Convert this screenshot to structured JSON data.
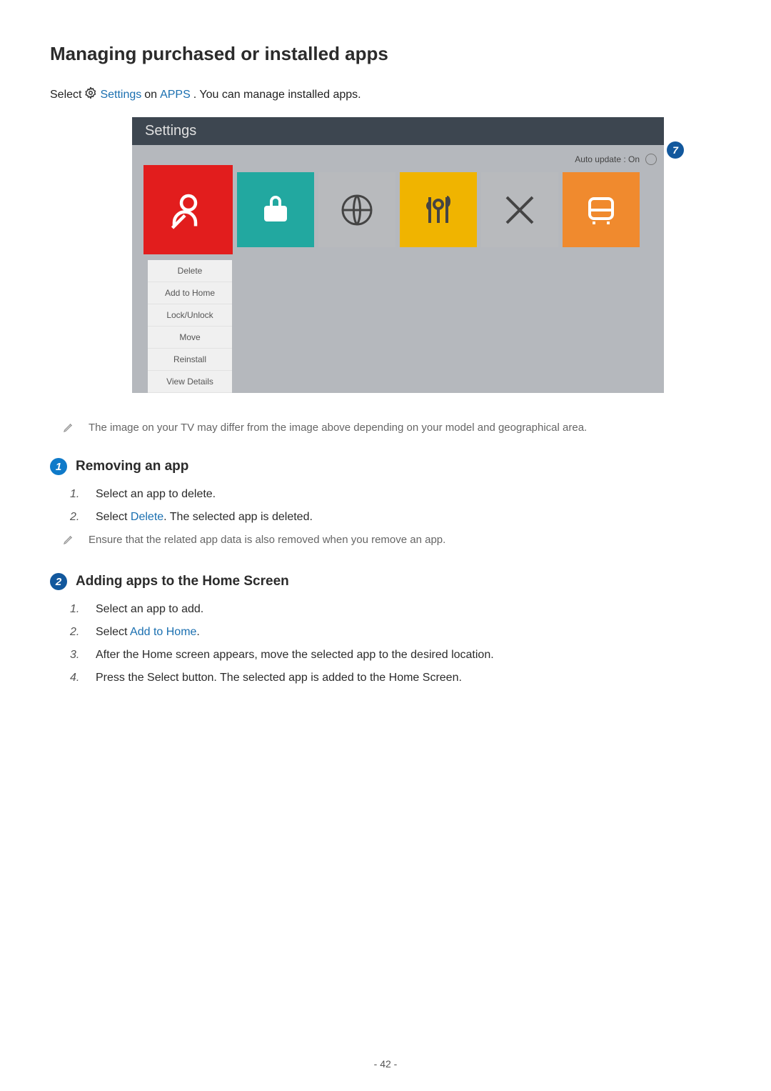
{
  "title": "Managing purchased or installed apps",
  "intro": {
    "prefix": "Select",
    "settings_link": "Settings",
    "on_word": "on",
    "apps_link": "APPS",
    "suffix": ". You can manage installed apps."
  },
  "screenshot": {
    "header": "Settings",
    "auto_update": "Auto update : On",
    "menu": [
      "Delete",
      "Add to Home",
      "Lock/Unlock",
      "Move",
      "Reinstall",
      "View Details"
    ]
  },
  "note1": "The image on your TV may differ from the image above depending on your model and geographical area.",
  "section1": {
    "num": "1",
    "title": "Removing an app",
    "steps": [
      {
        "n": "1.",
        "text": "Select an app to delete."
      },
      {
        "n": "2.",
        "prefix": "Select ",
        "link": "Delete",
        "suffix": ". The selected app is deleted."
      }
    ],
    "note": "Ensure that the related app data is also removed when you remove an app."
  },
  "section2": {
    "num": "2",
    "title": "Adding apps to the Home Screen",
    "steps": [
      {
        "n": "1.",
        "text": "Select an app to add."
      },
      {
        "n": "2.",
        "prefix": "Select ",
        "link": "Add to Home",
        "suffix": "."
      },
      {
        "n": "3.",
        "text": "After the Home screen appears, move the selected app to the desired location."
      },
      {
        "n": "4.",
        "text": "Press the Select button. The selected app is added to the Home Screen."
      }
    ]
  },
  "page_number": "- 42 -"
}
